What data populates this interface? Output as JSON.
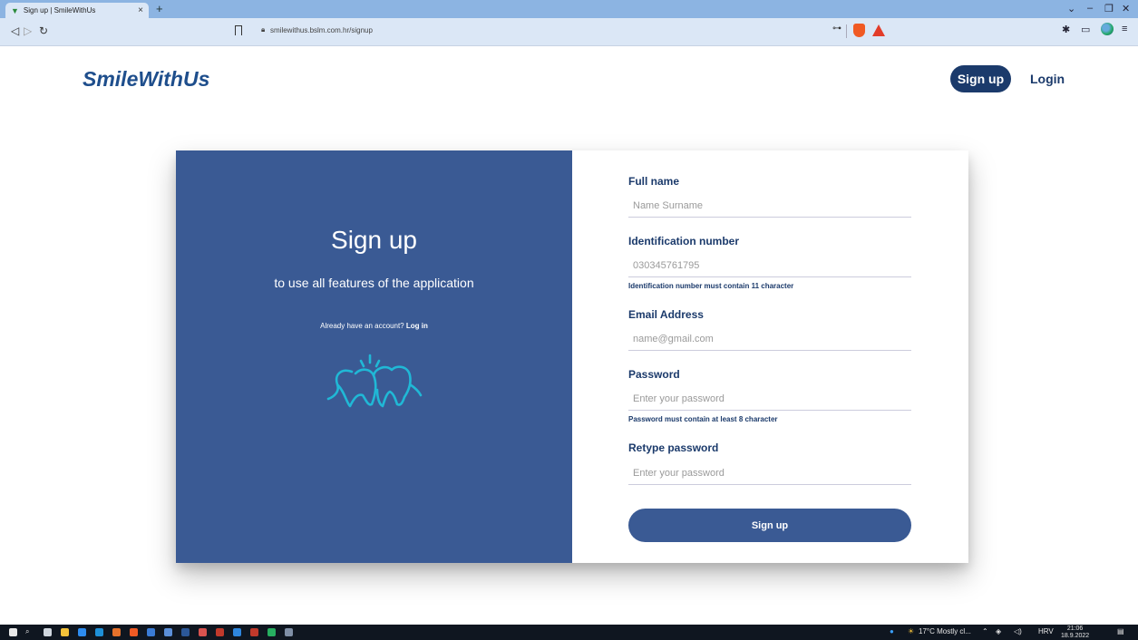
{
  "browser": {
    "tab_title": "Sign up | SmileWithUs",
    "tab_close": "×",
    "new_tab": "+",
    "url": "smilewithus.bslm.com.hr/signup"
  },
  "header": {
    "logo": "SmileWithUs",
    "nav_signup": "Sign up",
    "nav_login": "Login"
  },
  "left_panel": {
    "title": "Sign up",
    "subtitle": "to use all features of the application",
    "account_prompt": "Already have an account?",
    "login_link": "Log in",
    "illustration_color": "#20b8d6"
  },
  "form": {
    "full_name": {
      "label": "Full name",
      "placeholder": "Name Surname"
    },
    "id_number": {
      "label": "Identification number",
      "placeholder": "030345761795",
      "hint": "Identification number must contain 11 character"
    },
    "email": {
      "label": "Email Address",
      "placeholder": "name@gmail.com"
    },
    "password": {
      "label": "Password",
      "placeholder": "Enter your password",
      "hint": "Password must contain at least 8 character"
    },
    "retype_password": {
      "label": "Retype password",
      "placeholder": "Enter your password"
    },
    "submit_label": "Sign up"
  },
  "taskbar": {
    "weather": "17°C Mostly cl...",
    "language": "HRV",
    "time": "21:06",
    "date": "18.9.2022"
  },
  "colors": {
    "brand_dark": "#1b3a6b",
    "panel_blue": "#3a5a94",
    "logo_blue": "#1e4e8c"
  }
}
